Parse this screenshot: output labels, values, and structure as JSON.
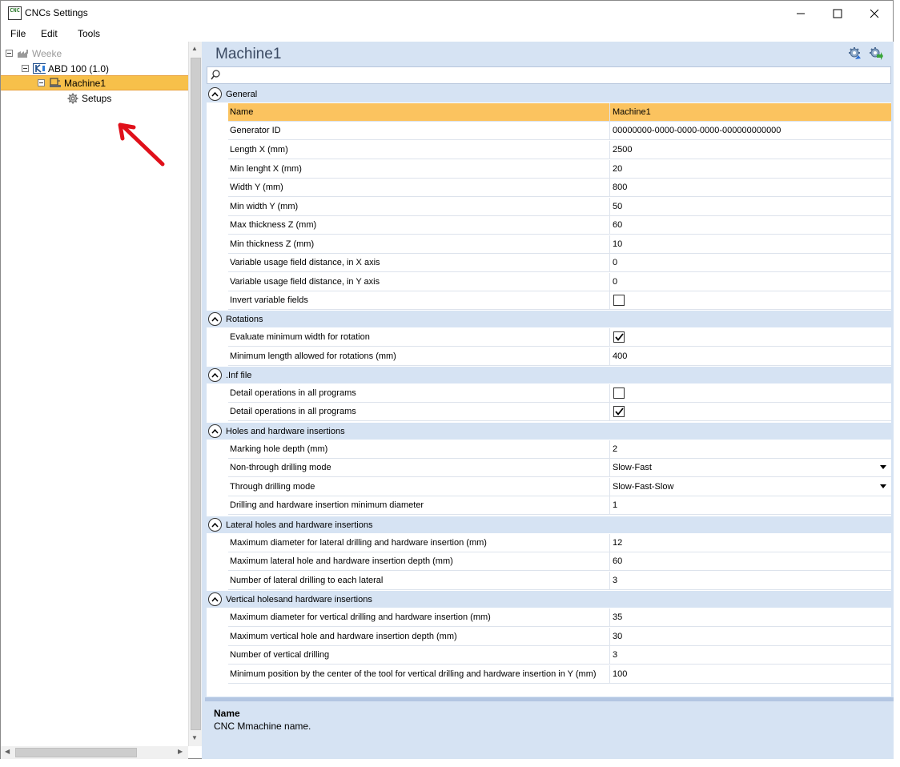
{
  "window": {
    "title": "CNCs Settings",
    "app_icon_text": "CNC",
    "controls": {
      "minimize": "minimize",
      "maximize": "maximize",
      "close": "close"
    }
  },
  "menu": {
    "file": "File",
    "edit": "Edit",
    "tools": "Tools"
  },
  "tree": {
    "root": {
      "label": "Weeke",
      "icon": "factory-icon"
    },
    "group": {
      "label": "ABD 100 (1.0)",
      "icon": "cnc-icon"
    },
    "machine": {
      "label": "Machine1",
      "icon": "machine-icon"
    },
    "setups": {
      "label": "Setups",
      "icon": "gear-icon"
    }
  },
  "panel": {
    "title": "Machine1",
    "search": {
      "value": "",
      "placeholder": ""
    }
  },
  "colors": {
    "selection": "#f7c04a",
    "panel_bg": "#d6e3f3",
    "arrow": "#e0101a"
  },
  "categories": {
    "general": {
      "label": "General",
      "rows": [
        {
          "name": "Name",
          "value": "Machine1"
        },
        {
          "name": "Generator ID",
          "value": "00000000-0000-0000-0000-000000000000"
        },
        {
          "name": "Length X (mm)",
          "value": "2500"
        },
        {
          "name": "Min lenght X (mm)",
          "value": "20"
        },
        {
          "name": "Width Y (mm)",
          "value": "800"
        },
        {
          "name": "Min width Y (mm)",
          "value": "50"
        },
        {
          "name": "Max thickness Z (mm)",
          "value": "60"
        },
        {
          "name": "Min thickness Z (mm)",
          "value": "10"
        },
        {
          "name": "Variable usage field distance, in X axis",
          "value": "0"
        },
        {
          "name": "Variable usage field distance, in Y axis",
          "value": "0"
        },
        {
          "name": "Invert variable fields",
          "checked": false
        }
      ]
    },
    "rotations": {
      "label": "Rotations",
      "rows": [
        {
          "name": "Evaluate minimum width for rotation",
          "checked": true
        },
        {
          "name": "Minimum length allowed for rotations (mm)",
          "value": "400"
        }
      ]
    },
    "inf": {
      "label": ".Inf file",
      "rows": [
        {
          "name": "Detail operations in all programs",
          "checked": false
        },
        {
          "name": "Detail operations in all programs",
          "checked": true
        }
      ]
    },
    "holes": {
      "label": "Holes and hardware insertions",
      "rows": [
        {
          "name": "Marking hole depth (mm)",
          "value": "2"
        },
        {
          "name": "Non-through drilling mode",
          "value": "Slow-Fast"
        },
        {
          "name": "Through drilling mode",
          "value": "Slow-Fast-Slow"
        },
        {
          "name": "Drilling and hardware insertion minimum diameter",
          "value": "1"
        }
      ]
    },
    "lateral": {
      "label": "Lateral holes and hardware insertions",
      "rows": [
        {
          "name": "Maximum diameter for lateral drilling and hardware insertion (mm)",
          "value": "12"
        },
        {
          "name": "Maximum lateral hole and hardware insertion depth (mm)",
          "value": "60"
        },
        {
          "name": "Number of lateral drilling to each lateral",
          "value": "3"
        }
      ]
    },
    "vertical": {
      "label": "Vertical holesand hardware insertions",
      "rows": [
        {
          "name": "Maximum diameter for vertical drilling and hardware insertion (mm)",
          "value": "35"
        },
        {
          "name": "Maximum vertical hole and hardware insertion depth (mm)",
          "value": "30"
        },
        {
          "name": "Number of vertical drilling",
          "value": "3"
        },
        {
          "name": "Minimum position by the center of the tool for vertical drilling and hardware insertion in Y (mm)",
          "value": "100"
        }
      ]
    }
  },
  "description": {
    "title": "Name",
    "text": "CNC Mmachine name."
  }
}
